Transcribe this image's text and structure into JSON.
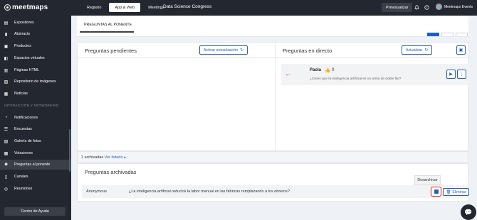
{
  "app": {
    "brand": "meetmaps",
    "event_title": "Data Science Congress"
  },
  "topnav": {
    "tabs": [
      {
        "label": "Registro"
      },
      {
        "label": "App & Web"
      },
      {
        "label": "Meetings"
      }
    ],
    "active": "App & Web"
  },
  "header": {
    "preview_label": "Previsualizar",
    "user_name": "Meetmaps Events",
    "icons": [
      "bell-icon",
      "help-icon",
      "info-icon"
    ]
  },
  "sidebar": {
    "items": [
      {
        "label": "Expositores",
        "icon": "store-icon"
      },
      {
        "label": "Abstracts",
        "icon": "bookmark-icon"
      },
      {
        "label": "Productos",
        "icon": "box-icon"
      },
      {
        "label": "Espacios virtuales",
        "icon": "book-icon"
      },
      {
        "label": "Páginas HTML",
        "icon": "page-icon"
      },
      {
        "label": "Repositorio de imágenes",
        "icon": "image-icon"
      },
      {
        "label": "Noticias",
        "icon": "news-icon"
      }
    ],
    "section_label": "INTERACCIÓN Y NETWORKING",
    "section_items": [
      {
        "label": "Notificaciones",
        "icon": "bell-icon"
      },
      {
        "label": "Encuestas",
        "icon": "list-icon"
      },
      {
        "label": "Galería de fotos",
        "icon": "gallery-icon"
      },
      {
        "label": "Votaciones",
        "icon": "vote-icon"
      },
      {
        "label": "Preguntas al ponente",
        "icon": "chat-icon"
      },
      {
        "label": "Canales",
        "icon": "channel-icon"
      },
      {
        "label": "Reuniones",
        "icon": "meeting-icon"
      }
    ],
    "active_item": "Preguntas al ponente",
    "help_label": "Centro de Ayuda"
  },
  "main": {
    "tab_label": "PREGUNTAS AL PONENTE",
    "pending": {
      "title": "Preguntas pendientes",
      "button_label": "Activar actualización"
    },
    "live": {
      "title": "Preguntas en directo",
      "button_label": "Actualizar",
      "question": {
        "author": "Paola",
        "likes": "0",
        "text": "¿Crees que la inteligencia artificial es un arma de doble filo?"
      }
    },
    "archive_bar": {
      "count_text": "1 archivadas",
      "link_label": "Ver listado"
    },
    "archived": {
      "title": "Preguntas archivadas",
      "row": {
        "author": "Anonymous",
        "text": "¿La inteligencia artificial reducirá la labor manual en las fábricas remplazando a los obreros?",
        "delete_label": "Eliminar"
      },
      "tooltip": "Desarchivar"
    }
  },
  "colors": {
    "dark": "#23272f",
    "accent": "#2a5fb5",
    "highlight_red": "#e0191f",
    "like_purple": "#7b3fb8"
  }
}
